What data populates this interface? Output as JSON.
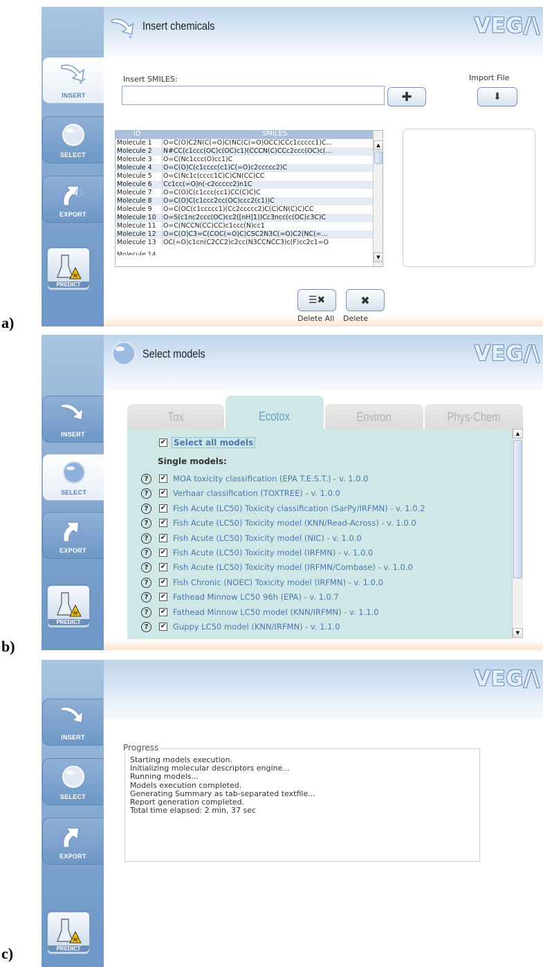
{
  "app": {
    "logo": "VEG/\\"
  },
  "nav": {
    "insert": "INSERT",
    "select": "SELECT",
    "export": "EXPORT",
    "predict": "PREDICT"
  },
  "panels": {
    "a": {
      "label": "a)",
      "title": "Insert chemicals",
      "smiles_label": "Insert SMILES:",
      "smiles_value": "",
      "import_label": "Import File",
      "table_headers": [
        "ID",
        "SMILES"
      ],
      "rows": [
        {
          "id": "Molecule 1",
          "smiles": "O=C(O)C2N(C(=O)C(NC(C(=O)OCC)CCc1ccccc1)C..."
        },
        {
          "id": "Molecule 2",
          "smiles": "N#CC(c1ccc(OC)c(OC)c1)(CCCN(C)CCc2ccc(OC)c(..."
        },
        {
          "id": "Molecule 3",
          "smiles": "O=C(Nc1ccc(O)cc1)C"
        },
        {
          "id": "Molecule 4",
          "smiles": "O=C(O)C(c1cccc(c1)C(=O)c2ccccc2)C"
        },
        {
          "id": "Molecule 5",
          "smiles": "O=C(Nc1c(cccc1C)C)CN(CC)CC"
        },
        {
          "id": "Molecule 6",
          "smiles": "Cc1cc(=O)n(-c2ccccc2)n1C"
        },
        {
          "id": "Molecule 7",
          "smiles": "O=C(O)C(c1ccc(cc1)CC(C)C)C"
        },
        {
          "id": "Molecule 8",
          "smiles": "O=C(O)C(c1ccc2cc(OC)ccc2(c1))C"
        },
        {
          "id": "Molecule 9",
          "smiles": "O=C(OC(c1ccccc1)(Cc2ccccc2)C(C)CN(C)C)CC"
        },
        {
          "id": "Molecule 10",
          "smiles": "O=S(c1nc2ccc(OC)cc2([nH]1))Cc3ncc(c(OC)c3C)C"
        },
        {
          "id": "Molecule 11",
          "smiles": "O=C(NCCN(CC)CC)c1ccc(N)cc1"
        },
        {
          "id": "Molecule 12",
          "smiles": "O=C(O)C3=C(COC(=O)C)CSC2N3C(=O)C2(NC(=..."
        },
        {
          "id": "Molecule 13",
          "smiles": "OC(=O)c1cn(C2CC2)c2cc(N3CCNCC3)c(F)cc2c1=O"
        }
      ],
      "delete_all_label": "Delete All",
      "delete_label": "Delete"
    },
    "b": {
      "label": "b)",
      "title": "Select models",
      "tabs": [
        "Tox",
        "Ecotox",
        "Environ",
        "Phys-Chem"
      ],
      "active_tab": "Ecotox",
      "select_all": "Select all models",
      "single_models_heading": "Single models:",
      "models": [
        "MOA toxicity classification (EPA T.E.S.T.) - v. 1.0.0",
        "Verhaar classification (TOXTREE) - v. 1.0.0",
        "Fish Acute (LC50) Toxicity classification (SarPy/IRFMN) - v. 1.0.2",
        "Fish Acute (LC50) Toxicity model (KNN/Read-Across) - v. 1.0.0",
        "Fish Acute (LC50) Toxicity model (NIC) - v. 1.0.0",
        "Fish Acute (LC50) Toxicity model (IRFMN) - v. 1.0.0",
        "Fish Acute (LC50) Toxicity model (IRFMN/Combase) - v. 1.0.0",
        "Fish Chronic (NOEC) Toxicity model (IRFMN) - v. 1.0.0",
        "Fathead Minnow LC50 96h (EPA) - v. 1.0.7",
        "Fathead Minnow LC50 model (KNN/IRFMN) - v. 1.1.0",
        "Guppy LC50 model (KNN/IRFMN) - v. 1.1.0"
      ]
    },
    "c": {
      "label": "c)",
      "progress_legend": "Progress",
      "progress_lines": [
        "Starting models execution.",
        "Initializing molecular descriptors engine...",
        "Running models...",
        "Models execution completed.",
        "Generating Summary as tab-separated textfile...",
        "Report generation completed.",
        "Total time elapsed: 2 min, 37 sec"
      ]
    }
  }
}
